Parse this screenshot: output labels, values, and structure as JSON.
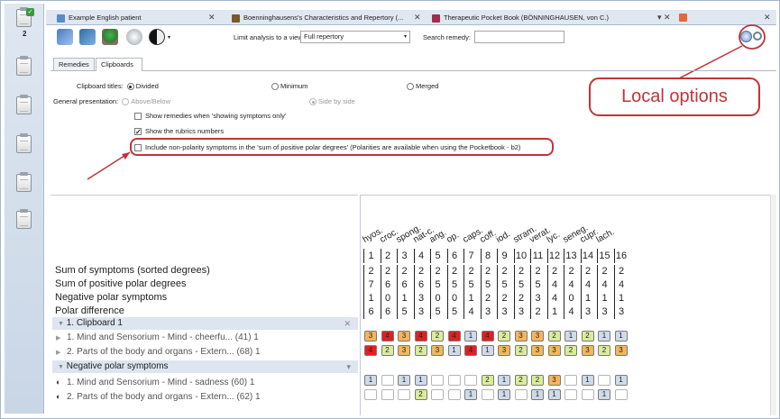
{
  "sidebar": {
    "count": "2",
    "check": "✓"
  },
  "tabs": [
    {
      "label": "Example English patient",
      "close": "✕",
      "icon_color": "#5b8ac6"
    },
    {
      "label": "Boenninghausens's Characteristics and Repertory (...",
      "close": "✕",
      "icon_color": "#7a5a2a"
    },
    {
      "label": "Therapeutic Pocket Book (BÖNNINGHAUSEN, von C.)",
      "close": "▾ ✕",
      "icon_color": "#a52a4a"
    }
  ],
  "window_close": "✕",
  "toolbar": {
    "filter_label": "Limit analysis to a view",
    "filter_value": "Full repertory",
    "search_label": "Search remedy:",
    "search_value": "",
    "dd_arrow": "▾"
  },
  "subtabs": [
    "Remedies",
    "Clipboards"
  ],
  "options": {
    "clipboard_titles_label": "Clipboard titles:",
    "divided": "Divided",
    "minimum": "Minimum",
    "merged": "Merged",
    "general_presentation_label": "General presentation:",
    "above_below": "Above/Below",
    "side_by_side": "Side by side",
    "show_remedies": "Show remedies when 'showing symptoms only'",
    "show_rubrics": "Show the rubrics numbers",
    "include_nonpolarity": "Include non-polarity symptoms in the 'sum of positive polar degrees' (Polarities are available when using the Pocketbook - b2)",
    "check_mark": "✓"
  },
  "callout": "Local options",
  "summary_labels": [
    "Sum of symptoms (sorted degrees)",
    "Sum of positive polar degrees",
    "Negative polar symptoms",
    "Polar difference"
  ],
  "remedies": [
    "hyos.",
    "croc.",
    "spong.",
    "nat-c.",
    "ang.",
    "op.",
    "caps.",
    "coff.",
    "iod.",
    "stram.",
    "verat.",
    "lyc.",
    "seneg.",
    "cupr.",
    "lach."
  ],
  "col_numbers": [
    "1",
    "2",
    "3",
    "4",
    "5",
    "6",
    "7",
    "8",
    "9",
    "10",
    "11",
    "12",
    "13",
    "14",
    "15",
    "16"
  ],
  "summary_rows": [
    [
      "2",
      "2",
      "2",
      "2",
      "2",
      "2",
      "2",
      "2",
      "2",
      "2",
      "2",
      "2",
      "2",
      "2",
      "2",
      "2"
    ],
    [
      "7",
      "6",
      "6",
      "6",
      "5",
      "5",
      "5",
      "5",
      "5",
      "5",
      "5",
      "4",
      "4",
      "4",
      "4",
      "4"
    ],
    [
      "1",
      "0",
      "1",
      "3",
      "0",
      "0",
      "1",
      "2",
      "2",
      "2",
      "3",
      "4",
      "0",
      "1",
      "1",
      "1"
    ],
    [
      "6",
      "6",
      "5",
      "3",
      "5",
      "5",
      "4",
      "3",
      "3",
      "3",
      "2",
      "1",
      "4",
      "3",
      "3",
      "3"
    ]
  ],
  "groups": [
    {
      "label": "1. Clipboard 1",
      "close": "✕",
      "lead": "▼",
      "symptoms": [
        {
          "label": "1. Mind and Sensorium - Mind - cheerfu... (41) 1",
          "lead": "▶",
          "cells": [
            [
              "3",
              "#f5b55b"
            ],
            [
              "4",
              "#e02020"
            ],
            [
              "3",
              "#f5b55b"
            ],
            [
              "4",
              "#e02020"
            ],
            [
              "2",
              "#d9ec9a"
            ],
            [
              "4",
              "#e02020"
            ],
            [
              "1",
              "#cfdbea"
            ],
            [
              "4",
              "#e02020"
            ],
            [
              "2",
              "#d9ec9a"
            ],
            [
              "3",
              "#f5b55b"
            ],
            [
              "3",
              "#f5b55b"
            ],
            [
              "2",
              "#d9ec9a"
            ],
            [
              "1",
              "#cfdbea"
            ],
            [
              "2",
              "#d9ec9a"
            ],
            [
              "1",
              "#cfdbea"
            ],
            [
              "1",
              "#cfdbea"
            ]
          ]
        },
        {
          "label": "2. Parts of the body and organs - Extern... (68) 1",
          "lead": "▶",
          "cells": [
            [
              "4",
              "#e02020"
            ],
            [
              "2",
              "#d9ec9a"
            ],
            [
              "3",
              "#f5b55b"
            ],
            [
              "2",
              "#d9ec9a"
            ],
            [
              "3",
              "#f5b55b"
            ],
            [
              "1",
              "#cfdbea"
            ],
            [
              "4",
              "#e02020"
            ],
            [
              "1",
              "#cfdbea"
            ],
            [
              "3",
              "#f5b55b"
            ],
            [
              "2",
              "#d9ec9a"
            ],
            [
              "3",
              "#f5b55b"
            ],
            [
              "3",
              "#f5b55b"
            ],
            [
              "2",
              "#d9ec9a"
            ],
            [
              "3",
              "#f5b55b"
            ],
            [
              "2",
              "#d9ec9a"
            ],
            [
              "3",
              "#f5b55b"
            ]
          ]
        }
      ]
    },
    {
      "label": "Negative polar symptoms",
      "close": "▾",
      "lead": "▼",
      "symptoms": [
        {
          "label": "1. Mind and Sensorium - Mind - sadness  (60) 1",
          "lead": "◐",
          "cells": [
            [
              "1",
              "#cfdbea"
            ],
            [
              "",
              ""
            ],
            [
              "1",
              "#cfdbea"
            ],
            [
              "1",
              "#cfdbea"
            ],
            [
              "",
              ""
            ],
            [
              "",
              ""
            ],
            [
              "",
              ""
            ],
            [
              "2",
              "#d9ec9a"
            ],
            [
              "1",
              "#cfdbea"
            ],
            [
              "2",
              "#d9ec9a"
            ],
            [
              "2",
              "#d9ec9a"
            ],
            [
              "3",
              "#f5b55b"
            ],
            [
              "",
              ""
            ],
            [
              "1",
              "#cfdbea"
            ],
            [
              "",
              ""
            ],
            [
              "1",
              "#cfdbea"
            ]
          ]
        },
        {
          "label": "2. Parts of the body and organs - Extern... (62) 1",
          "lead": "◐",
          "cells": [
            [
              "",
              ""
            ],
            [
              "",
              ""
            ],
            [
              "",
              ""
            ],
            [
              "2",
              "#d9ec9a"
            ],
            [
              "",
              ""
            ],
            [
              "",
              ""
            ],
            [
              "1",
              "#cfdbea"
            ],
            [
              "",
              ""
            ],
            [
              "1",
              "#cfdbea"
            ],
            [
              "",
              ""
            ],
            [
              "1",
              "#cfdbea"
            ],
            [
              "1",
              "#cfdbea"
            ],
            [
              "",
              ""
            ],
            [
              "",
              ""
            ],
            [
              "1",
              "#cfdbea"
            ],
            [
              "",
              ""
            ]
          ]
        }
      ]
    }
  ]
}
